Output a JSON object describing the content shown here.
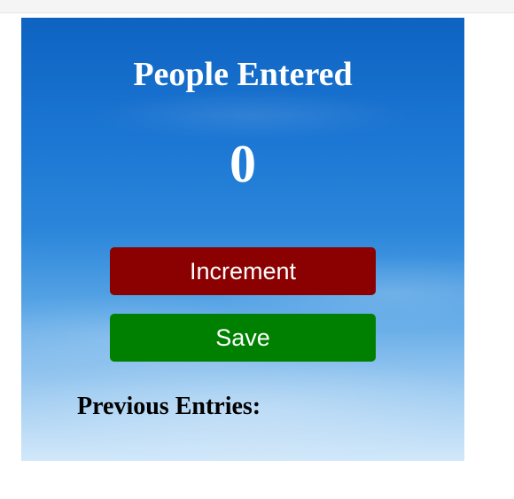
{
  "app": {
    "title": "People Entered",
    "count": "0"
  },
  "buttons": {
    "increment_label": "Increment",
    "save_label": "Save"
  },
  "entries": {
    "label": "Previous Entries:"
  },
  "colors": {
    "increment_button": "#8b0000",
    "save_button": "#008000",
    "text_light": "#ffffff",
    "text_dark": "#000000",
    "background_sky_top": "#0e63c1",
    "background_sky_bottom": "#d2e8fa"
  }
}
